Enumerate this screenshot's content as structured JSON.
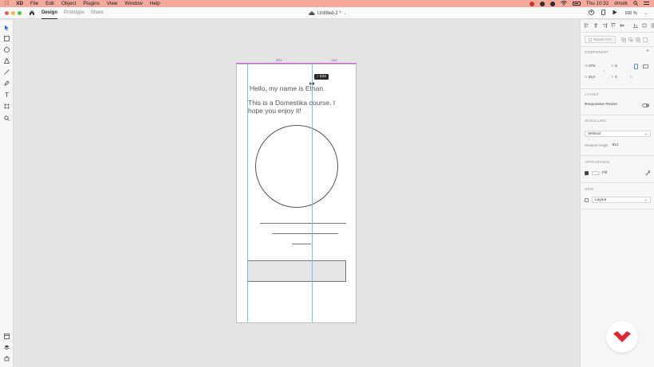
{
  "menubar": {
    "app_name": "XD",
    "items": [
      "File",
      "Edit",
      "Object",
      "Plugins",
      "View",
      "Window",
      "Help"
    ],
    "clock": "Thu 10:32",
    "user": "dmstk"
  },
  "titlebar": {
    "tabs": [
      "Design",
      "Prototype",
      "Share"
    ],
    "doc_title": "Untitled-2 *",
    "zoom": "100 %"
  },
  "canvas": {
    "guide_label_left": "201",
    "guide_label_right": "141",
    "measure_label": "↕ 234",
    "artboard": {
      "heading": "Hello, my name is Ethan.",
      "paragraph": "This is a Domestika course. I hope you enjoy it!"
    }
  },
  "rightpanel": {
    "repeat_grid": "Repeat Grid",
    "component_head": "COMPONENT",
    "w_label": "W",
    "w_value": "375",
    "x_label": "X",
    "x_value": "0",
    "h_label": "H",
    "h_value": "812",
    "y_label": "Y",
    "y_value": "0",
    "layout_head": "LAYOUT",
    "responsive_resize": "Responsive Resize",
    "scrolling_head": "SCROLLING",
    "scroll_value": "Vertical",
    "viewport_label": "Viewport Height",
    "viewport_value": "812",
    "appearance_head": "APPEARANCE",
    "fill_label": "Fill",
    "grid_head": "GRID",
    "grid_value": "Layout"
  },
  "colors": {
    "menubar": "#f4a99b",
    "guide": "#5fd0e0",
    "guide_top": "#d25be0",
    "canvas_bg": "#e4e4e4",
    "badge": "#e0262d"
  }
}
